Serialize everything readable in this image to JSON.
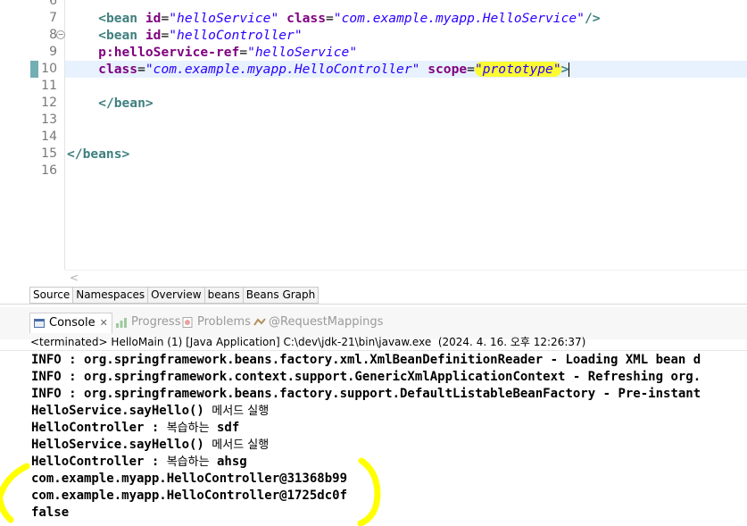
{
  "editor": {
    "top_partial_line_number": "6",
    "lines": [
      {
        "num": "7",
        "parts": [
          {
            "t": "    ",
            "c": ""
          },
          {
            "t": "<bean ",
            "c": "tag"
          },
          {
            "t": "id",
            "c": "attr"
          },
          {
            "t": "=",
            "c": ""
          },
          {
            "t": "\"helloService\"",
            "c": "val"
          },
          {
            "t": " ",
            "c": ""
          },
          {
            "t": "class",
            "c": "attr"
          },
          {
            "t": "=",
            "c": ""
          },
          {
            "t": "\"com.example.myapp.HelloService\"",
            "c": "val"
          },
          {
            "t": "/>",
            "c": "tag"
          }
        ]
      },
      {
        "num": "8",
        "parts": [
          {
            "t": "    ",
            "c": ""
          },
          {
            "t": "<bean ",
            "c": "tag"
          },
          {
            "t": "id",
            "c": "attr"
          },
          {
            "t": "=",
            "c": ""
          },
          {
            "t": "\"helloController\"",
            "c": "val"
          }
        ]
      },
      {
        "num": "9",
        "parts": [
          {
            "t": "    ",
            "c": ""
          },
          {
            "t": "p:helloService-ref",
            "c": "attr"
          },
          {
            "t": "=",
            "c": ""
          },
          {
            "t": "\"helloService\"",
            "c": "val"
          }
        ]
      },
      {
        "num": "10",
        "parts": [
          {
            "t": "    ",
            "c": ""
          },
          {
            "t": "class",
            "c": "attr"
          },
          {
            "t": "=",
            "c": ""
          },
          {
            "t": "\"com.example.myapp.HelloController\"",
            "c": "val"
          },
          {
            "t": " ",
            "c": ""
          },
          {
            "t": "scope",
            "c": "attr"
          },
          {
            "t": "=",
            "c": ""
          },
          {
            "t": "\"prototype\"",
            "c": "val hl"
          },
          {
            "t": ">",
            "c": "tag"
          }
        ]
      },
      {
        "num": "11",
        "parts": []
      },
      {
        "num": "12",
        "parts": [
          {
            "t": "    ",
            "c": ""
          },
          {
            "t": "</bean>",
            "c": "tag"
          }
        ]
      },
      {
        "num": "13",
        "parts": []
      },
      {
        "num": "14",
        "parts": []
      },
      {
        "num": "15",
        "parts": [
          {
            "t": "</beans>",
            "c": "tag"
          }
        ]
      },
      {
        "num": "16",
        "parts": []
      }
    ],
    "tabs": [
      "Source",
      "Namespaces",
      "Overview",
      "beans",
      "Beans Graph"
    ]
  },
  "views": {
    "console_label": "Console",
    "close_glyph": "✕",
    "progress_label": "Progress",
    "problems_label": "Problems",
    "request_label": "@RequestMappings"
  },
  "console": {
    "terminated_line": "<terminated> HelloMain (1) [Java Application] C:\\dev\\jdk-21\\bin\\javaw.exe  (2024. 4. 16. 오후 12:26:37)",
    "output": [
      {
        "code": "INFO : org.springframework.beans.factory.xml.XmlBeanDefinitionReader - Loading XML bean d",
        "ko": ""
      },
      {
        "code": "INFO : org.springframework.context.support.GenericXmlApplicationContext - Refreshing org.",
        "ko": ""
      },
      {
        "code": "INFO : org.springframework.beans.factory.support.DefaultListableBeanFactory - Pre-instant",
        "ko": ""
      },
      {
        "code": "HelloService.sayHello() ",
        "ko": "메서드 실행"
      },
      {
        "code": "HelloController : ",
        "ko": "복습하는",
        "tail": " sdf"
      },
      {
        "code": "HelloService.sayHello() ",
        "ko": "메서드 실행"
      },
      {
        "code": "HelloController : ",
        "ko": "복습하는",
        "tail": " ahsg"
      },
      {
        "code": "com.example.myapp.HelloController@31368b99",
        "ko": ""
      },
      {
        "code": "com.example.myapp.HelloController@1725dc0f",
        "ko": ""
      },
      {
        "code": "false",
        "ko": ""
      }
    ]
  },
  "colors": {
    "highlight": "#fbfb32",
    "annotation": "#ffff00",
    "tag": "#3f7f7f",
    "attr": "#7f007f",
    "value": "#2a00ff"
  }
}
